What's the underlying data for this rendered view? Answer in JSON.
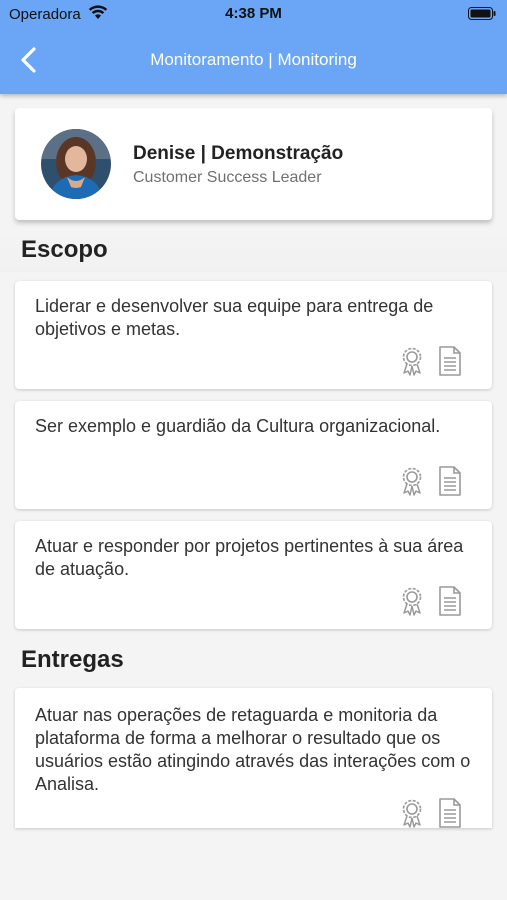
{
  "status_bar": {
    "carrier": "Operadora",
    "time": "4:38 PM"
  },
  "header": {
    "title": "Monitoramento | Monitoring"
  },
  "profile": {
    "name": "Denise | Demonstração",
    "role": "Customer Success Leader"
  },
  "sections": {
    "scope_title": "Escopo",
    "deliveries_title": "Entregas"
  },
  "scope_items": [
    {
      "text": "Liderar e desenvolver sua equipe para entrega de objetivos e metas."
    },
    {
      "text": "Ser exemplo e guardião da Cultura organizacional."
    },
    {
      "text": "Atuar e responder por projetos pertinentes à sua área de atuação."
    }
  ],
  "delivery_items": [
    {
      "text": "Atuar nas operações de retaguarda e monitoria da plataforma de forma a melhorar o resultado que os usuários estão atingindo através das interações com o Analisa."
    }
  ],
  "colors": {
    "header_bg": "#6aa6f5",
    "page_bg": "#f4f4f4",
    "icon_gray": "#9a9a9a"
  }
}
